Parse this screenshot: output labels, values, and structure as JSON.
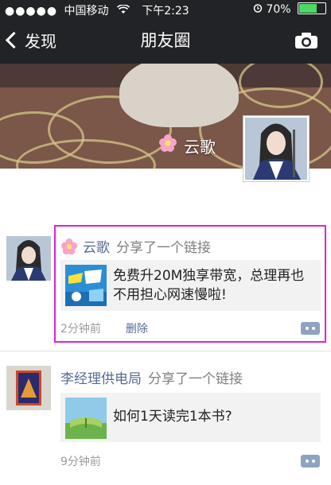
{
  "status_bar": {
    "signal": "●●●●●",
    "carrier": "中国移动",
    "time": "下午2:23",
    "battery": "70%"
  },
  "nav": {
    "back_label": "发现",
    "title": "朋友圈"
  },
  "profile": {
    "name": "云歌"
  },
  "posts": [
    {
      "author": "云歌",
      "action": "分享了一个链接",
      "link_text": "免费升20M独享带宽，总理再也不用担心网速慢啦!",
      "time": "2分钟前",
      "delete_label": "删除"
    },
    {
      "author": "李经理供电局",
      "action": "分享了一个链接",
      "link_text": "如何1天读完1本书?",
      "time": "9分钟前"
    }
  ],
  "colors": {
    "accent_name": "#576b95",
    "highlight": "#e020d5"
  }
}
